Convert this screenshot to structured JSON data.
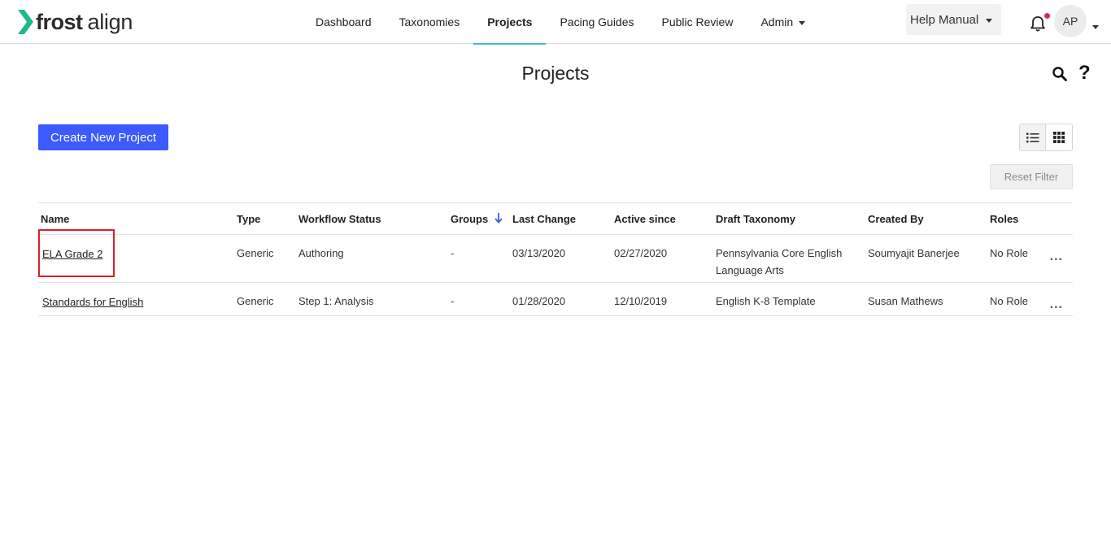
{
  "brand": {
    "word1": "frost",
    "word2": "align",
    "accent": "#1fb88a"
  },
  "nav": {
    "items": [
      {
        "label": "Dashboard"
      },
      {
        "label": "Taxonomies"
      },
      {
        "label": "Projects"
      },
      {
        "label": "Pacing Guides"
      },
      {
        "label": "Public Review"
      },
      {
        "label": "Admin"
      }
    ],
    "active": "Projects"
  },
  "header": {
    "help_label": "Help Manual",
    "avatar_initials": "AP",
    "notification_dot_color": "#d9265a"
  },
  "page": {
    "title": "Projects",
    "create_button": "Create New Project",
    "reset_filter": "Reset Filter",
    "primary_color": "#3d5afe"
  },
  "table": {
    "columns": [
      "Name",
      "Type",
      "Workflow Status",
      "Groups",
      "Last Change",
      "Active since",
      "Draft Taxonomy",
      "Created By",
      "Roles"
    ],
    "sorted_column": "Groups",
    "rows": [
      {
        "name": "ELA Grade 2",
        "type": "Generic",
        "status": "Authoring",
        "groups": "-",
        "last_change": "03/13/2020",
        "active_since": "02/27/2020",
        "taxonomy_line1": "Pennsylvania Core English",
        "taxonomy_line2": "Language Arts",
        "created_by": "Soumyajit Banerjee",
        "roles": "No Role",
        "more": "..."
      },
      {
        "name": "Standards for English",
        "type": "Generic",
        "status": "Step 1: Analysis",
        "groups": "-",
        "last_change": "01/28/2020",
        "active_since": "12/10/2019",
        "taxonomy_line1": "English K-8 Template",
        "created_by": "Susan Mathews",
        "roles": "No Role",
        "more": "..."
      }
    ]
  },
  "icons": [
    "frost-logo-icon",
    "caret-down-icon",
    "bell-icon",
    "search-icon",
    "question-icon",
    "list-view-icon",
    "grid-view-icon",
    "sort-down-arrow-icon",
    "more-options-icon"
  ]
}
